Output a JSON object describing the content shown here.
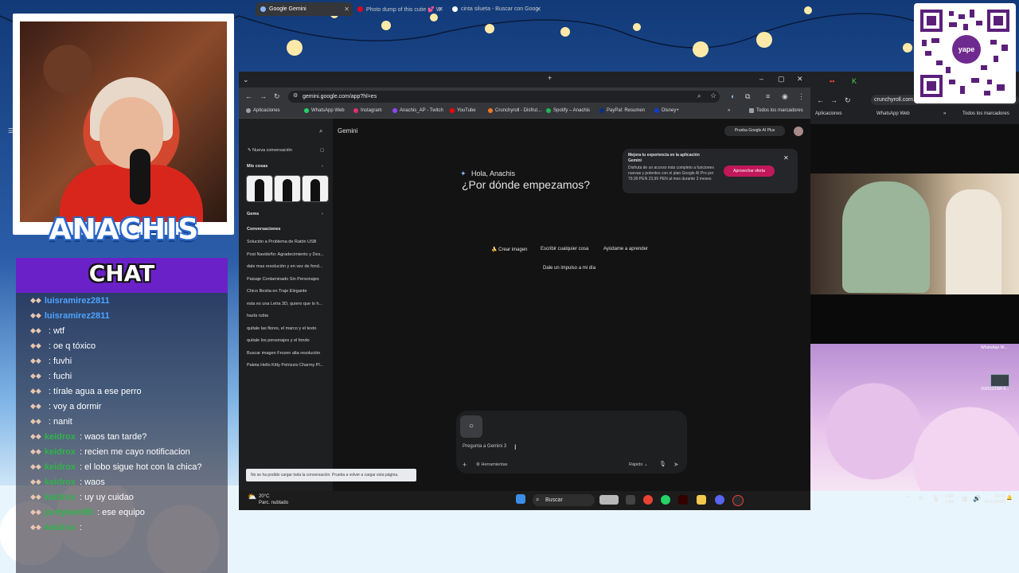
{
  "stream": {
    "streamer_name": "ANACHIS",
    "chat_title": "CHAT",
    "chat_messages": [
      {
        "user": "luisramirez2811",
        "message": "",
        "user_color": "#4ea3ff"
      },
      {
        "user": "luisramirez2811",
        "message": "",
        "user_color": "#4ea3ff"
      },
      {
        "user": "",
        "message": ": wtf",
        "user_color": "#e0442e"
      },
      {
        "user": "",
        "message": ": oe q tóxico",
        "user_color": "#e0442e"
      },
      {
        "user": "",
        "message": ": fuvhi",
        "user_color": "#e0442e"
      },
      {
        "user": "",
        "message": ": fuchi",
        "user_color": "#e0442e"
      },
      {
        "user": "",
        "message": ": tírale agua a ese perro",
        "user_color": "#e0442e"
      },
      {
        "user": "",
        "message": ": voy a dormir",
        "user_color": "#e0442e"
      },
      {
        "user": "",
        "message": ": nanit",
        "user_color": "#e0442e"
      },
      {
        "user": "keidrox",
        "message": ": waos tan tarde?",
        "user_color": "#2fb34a"
      },
      {
        "user": "keidrox",
        "message": ": recien me cayo notificacion",
        "user_color": "#2fb34a"
      },
      {
        "user": "keidrox",
        "message": ": el lobo sigue hot con la chica?",
        "user_color": "#2fb34a"
      },
      {
        "user": "keidrox",
        "message": ": waos",
        "user_color": "#2fb34a"
      },
      {
        "user": "keidrox",
        "message": ": uy uy cuidao",
        "user_color": "#2fb34a"
      },
      {
        "user": "jordykenl05",
        "message": ": ese equipo",
        "user_color": "#2fb34a"
      },
      {
        "user": "keidrox",
        "message": ":",
        "user_color": "#2fb34a"
      }
    ]
  },
  "browser": {
    "tabs": [
      {
        "label": "Google Gemini",
        "active": true,
        "icon_color": "#8ab4f8"
      },
      {
        "label": "Photo dump of this cutie 💕 W",
        "active": false,
        "icon_color": "#e60023"
      },
      {
        "label": "cinta silueta - Buscar con Goog",
        "active": false,
        "icon_color": "#ffffff"
      }
    ],
    "new_tab_label": "+",
    "url": "gemini.google.com/app?hl=es",
    "bookmarks": [
      {
        "label": "Aplicaciones",
        "color": "#9aa0a6"
      },
      {
        "label": "WhatsApp Web",
        "color": "#25d366"
      },
      {
        "label": "Instagram",
        "color": "#e1306c"
      },
      {
        "label": "Anachis_AP - Twitch",
        "color": "#9146ff"
      },
      {
        "label": "YouTube",
        "color": "#ff0000"
      },
      {
        "label": "Crunchyroll - Disfrut...",
        "color": "#f47521"
      },
      {
        "label": "Spotify – Anachis",
        "color": "#1db954"
      },
      {
        "label": "PayPal: Resumen",
        "color": "#003087"
      },
      {
        "label": "Disney+",
        "color": "#113ccf"
      }
    ],
    "all_bookmarks_label": "Todos los marcadores"
  },
  "gemini": {
    "app_title": "Gemini",
    "new_chat": "Nueva conversación",
    "my_stuff": "Mis cosas",
    "gems": "Gems",
    "conversations_header": "Conversaciones",
    "conversations": [
      "Solución a Problema de Ratón USB",
      "Post Navideño: Agradecimiento y Des...",
      "dale mas resolución y en vez de fond...",
      "Paisaje Contaminado Sin Personajes",
      "Chico Bestia en Traje Elegante",
      "esta es una Letra 3D, quiero que lo h...",
      "hazla rubia",
      "quitale las flores, el marco y el texto",
      "quitale los personajes y el fondo",
      "Buscar imagen Frozen alta resolución",
      "Paleta Hello Kitty Petrizzio Charmy Pl..."
    ],
    "try_pro": "Prueba Google AI Plus",
    "greeting": "Hola, Anachis",
    "question": "¿Por dónde empezamos?",
    "promo_title": "Mejora tu experiencia en la aplicación Gemini",
    "promo_text": "Disfruta de un acceso más completo a funciones nuevas y potentes con el plan Google AI Pro por 79,99 PEN 23,99 PEN al mes durante 3 meses",
    "promo_button": "Aprovechar oferta",
    "chips": [
      "🍌 Crear imagen",
      "Escribir cualquier cosa",
      "Ayúdame a aprender",
      "Dale un impulso a mi día"
    ],
    "input_placeholder": "Pregunta a Gemini 3",
    "tools": "Herramientas",
    "mode": "Rápido",
    "toast": "No se ha podido cargar toda la conversación. Prueba a volver a cargar esta página."
  },
  "taskbar": {
    "temperature": "20°C",
    "weather": "Parc. nublado",
    "search": "Buscar",
    "lang": "ESP",
    "lang2": "LAA",
    "time": "01:41",
    "date": "28/12/2025"
  },
  "browser2": {
    "url": "crunchyroll.com",
    "bookmarks": [
      "Aplicaciones",
      "WhatsApp Web",
      "Todos los marcadores"
    ],
    "thumb_label": "WhatsApp W...",
    "thumb_label2": "20251223W 6..."
  },
  "qr": {
    "brand": "yape"
  }
}
